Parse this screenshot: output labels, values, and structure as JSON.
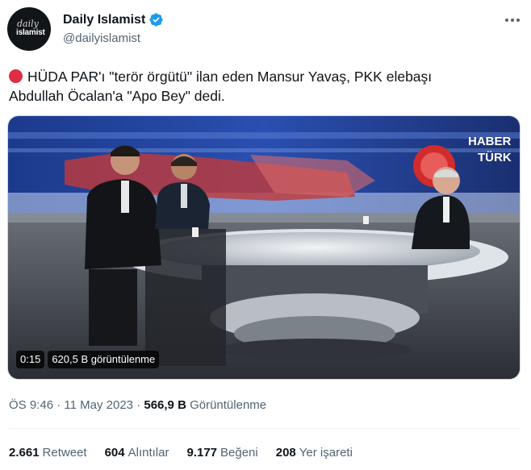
{
  "author": {
    "display_name": "Daily Islamist",
    "handle": "@dailyislamist",
    "avatar_text_line1": "daily",
    "avatar_text_line2": "islamist",
    "verified_icon": "verified-badge-icon",
    "verified_color": "#1d9bf0"
  },
  "tweet": {
    "bullet_icon": "red-circle-icon",
    "text_line1": "HÜDA PAR'ı \"terör örgütü\" ilan eden Mansur Yavaş, PKK elebaşı",
    "text_line2": "Abdullah Öcalan'a \"Apo Bey\" dedi."
  },
  "video": {
    "duration": "0:15",
    "views": "620,5 B görüntülenme",
    "channel_logo_text1": "HABER",
    "channel_logo_text2": "TÜRK"
  },
  "meta": {
    "time": "ÖS 9:46",
    "separator": "·",
    "date": "11 May 2023",
    "separator2": "·",
    "views_count": "566,9 B",
    "views_label": "Görüntülenme"
  },
  "stats": {
    "retweets_count": "2.661",
    "retweets_label": "Retweet",
    "quotes_count": "604",
    "quotes_label": "Alıntılar",
    "likes_count": "9.177",
    "likes_label": "Beğeni",
    "bookmarks_count": "208",
    "bookmarks_label": "Yer işareti"
  },
  "colors": {
    "text_primary": "#0f1419",
    "text_secondary": "#536471",
    "accent": "#1d9bf0",
    "red_dot": "#dd2e44"
  }
}
